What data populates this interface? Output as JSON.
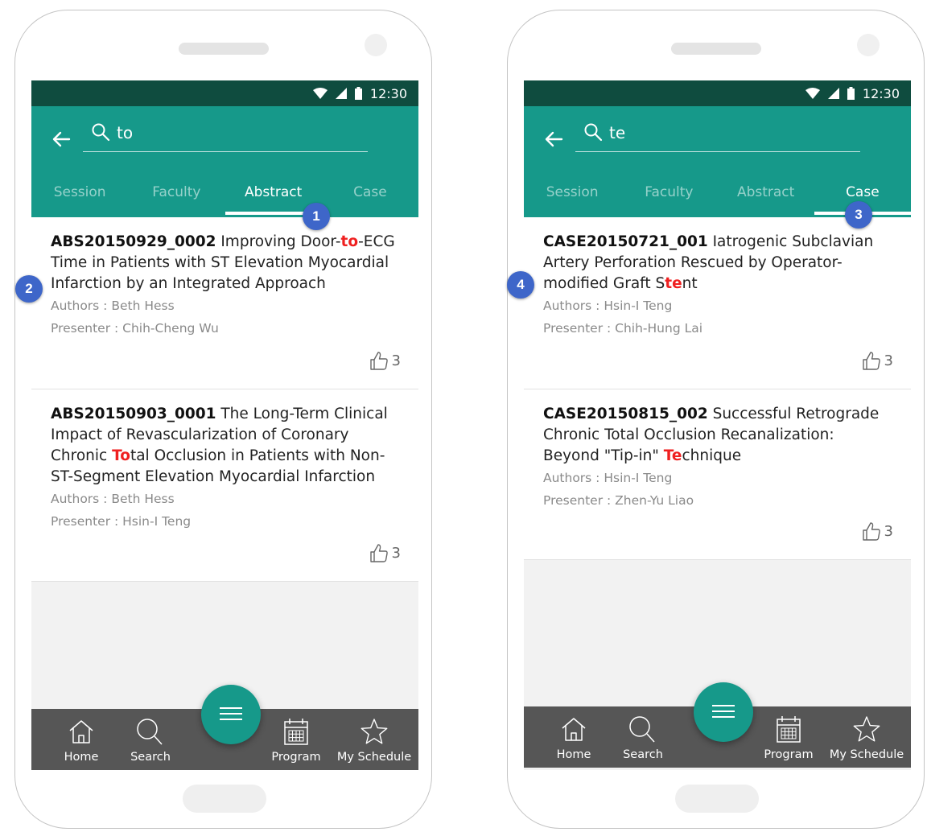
{
  "status": {
    "time": "12:30"
  },
  "phones": [
    {
      "query": "to",
      "tabs": [
        "Session",
        "Faculty",
        "Abstract",
        "Case"
      ],
      "active_tab": "Abstract",
      "results": [
        {
          "code": "ABS20150929_0002",
          "title_parts": [
            " Improving Door-",
            "to",
            "-ECG Time in Patients with ST Elevation Myocardial Infarction by an Integrated Approach"
          ],
          "authors": "Authors :  Beth Hess",
          "presenter": "Presenter : Chih-Cheng Wu",
          "likes": "3"
        },
        {
          "code": "ABS20150903_0001",
          "title_parts": [
            " The Long-Term Clinical Impact of Revascularization of Coronary Chronic ",
            "To",
            "tal Occlusion in Patients with Non-ST-Segment Elevation Myocardial Infarction"
          ],
          "authors": "Authors :  Beth Hess",
          "presenter": "Presenter : Hsin-I Teng",
          "likes": "3"
        }
      ],
      "markers": [
        "1",
        "2"
      ]
    },
    {
      "query": "te",
      "tabs": [
        "Session",
        "Faculty",
        "Abstract",
        "Case"
      ],
      "active_tab": "Case",
      "results": [
        {
          "code": "CASE20150721_001",
          "title_parts": [
            " Iatrogenic Subclavian Artery Perforation Rescued by Operator-modified Graft S",
            "te",
            "nt"
          ],
          "authors": "Authors : Hsin-I Teng",
          "presenter": "Presenter : Chih-Hung Lai",
          "likes": "3"
        },
        {
          "code": "CASE20150815_002",
          "title_parts": [
            " Successful Retrograde Chronic Total Occlusion Recanalization: Beyond \"Tip-in\" ",
            "Te",
            "chnique"
          ],
          "authors": "Authors : Hsin-I Teng",
          "presenter": "Presenter : Zhen-Yu Liao",
          "likes": "3"
        }
      ],
      "markers": [
        "3",
        "4"
      ]
    }
  ],
  "nav": {
    "home": "Home",
    "search": "Search",
    "program": "Program",
    "schedule": "My Schedule"
  },
  "colors": {
    "primary": "#16998a",
    "statusbar": "#0f4c3f",
    "highlight": "#ef2020",
    "marker": "#3e66c9",
    "nav_bg": "#565656"
  },
  "icons": [
    "back-arrow-icon",
    "search-icon",
    "wifi-icon",
    "signal-icon",
    "battery-icon",
    "thumbs-up-icon",
    "home-icon",
    "search-icon",
    "menu-icon",
    "calendar-icon",
    "star-icon"
  ]
}
